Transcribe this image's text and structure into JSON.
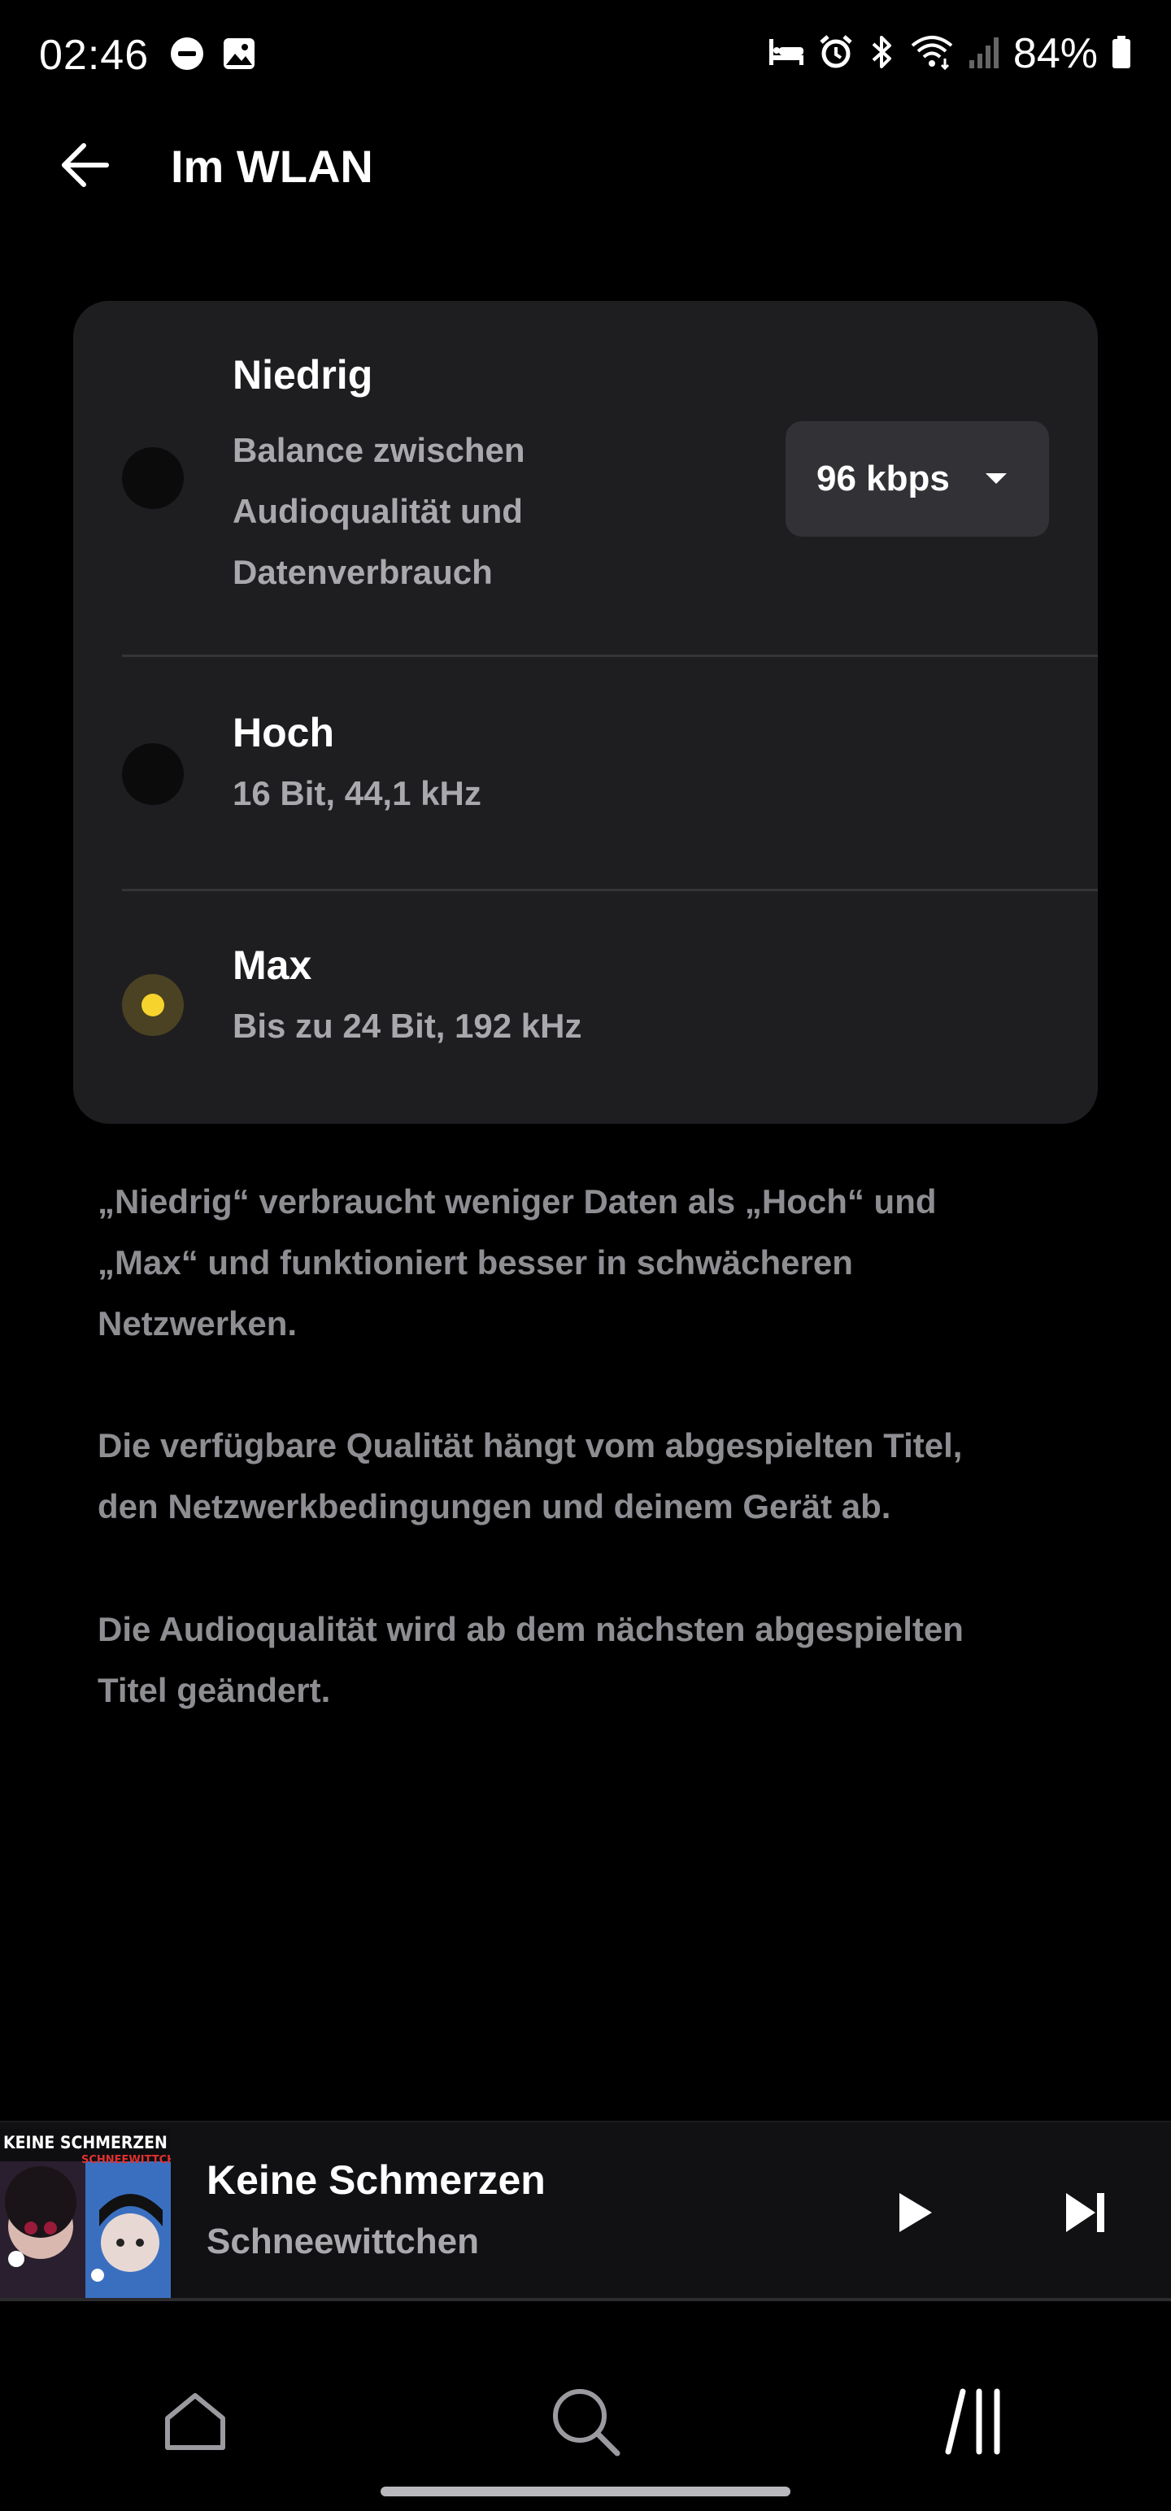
{
  "status_bar": {
    "time": "02:46",
    "battery_percent": "84%",
    "left_icons": [
      "dnd-icon",
      "image-icon"
    ],
    "right_icons": [
      "sleep-icon",
      "alarm-icon",
      "bluetooth-icon",
      "wifi-icon",
      "signal-icon",
      "battery-icon"
    ]
  },
  "header": {
    "title": "Im WLAN",
    "back_icon": "arrow-left-icon"
  },
  "options": [
    {
      "title": "Niedrig",
      "description": [
        "Balance zwischen",
        "Audioqualität und",
        "Datenverbrauch"
      ],
      "selected": false,
      "bitrate": "96 kbps"
    },
    {
      "title": "Hoch",
      "description": [
        "16 Bit, 44,1 kHz"
      ],
      "selected": false
    },
    {
      "title": "Max",
      "description": [
        "Bis zu 24 Bit, 192 kHz"
      ],
      "selected": true
    }
  ],
  "info": {
    "p1": [
      "„Niedrig“ verbraucht weniger Daten als „Hoch“ und",
      "„Max“ und funktioniert besser in schwächeren",
      "Netzwerken."
    ],
    "p2": [
      "Die verfügbare Qualität hängt vom abgespielten Titel,",
      "den Netzwerkbedingungen und deinem Gerät ab."
    ],
    "p3": [
      "Die Audioqualität wird ab dem nächsten abgespielten",
      "Titel geändert."
    ]
  },
  "player": {
    "title": "Keine Schmerzen",
    "artist": "Schneewittchen",
    "album_art_text_1": "KEINE SCHMERZEN",
    "album_art_text_2": "SCHNEEWITTCHEN",
    "play_icon": "play-icon",
    "next_icon": "skip-next-icon"
  },
  "nav": {
    "items": [
      "home-icon",
      "search-icon",
      "library-icon"
    ]
  },
  "colors": {
    "background": "#000000",
    "card": "#1e1e21",
    "accent": "#f6d32d",
    "muted_text": "#8d8d92"
  }
}
